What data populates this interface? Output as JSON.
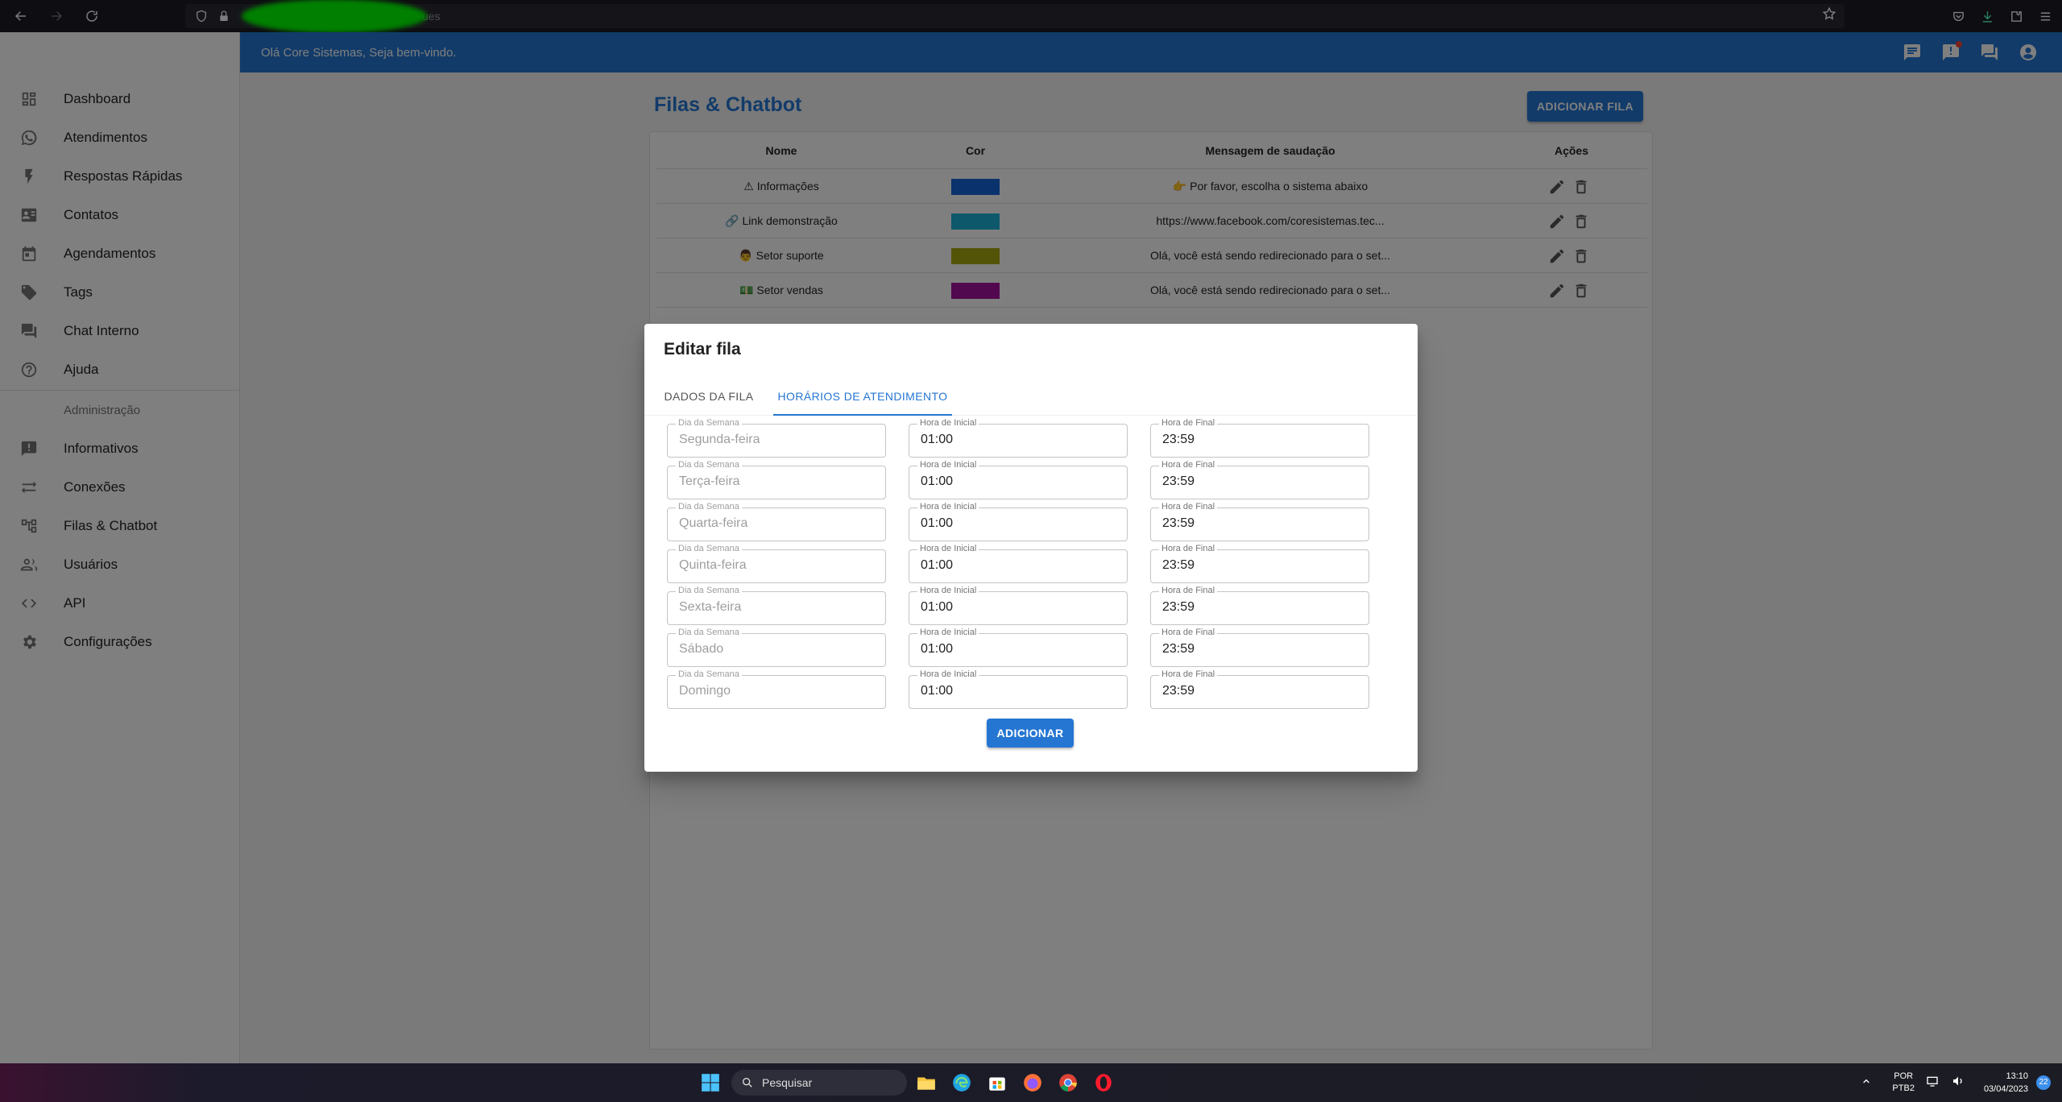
{
  "browser": {
    "url_suffix": "ues",
    "icons": [
      "back-arrow-icon",
      "forward-arrow-icon",
      "reload-icon",
      "shield-icon",
      "lock-icon",
      "star-icon",
      "pocket-icon",
      "download-icon",
      "extensions-icon",
      "menu-icon"
    ]
  },
  "sidebar": {
    "items": [
      {
        "label": "Dashboard",
        "icon": "dashboard-icon"
      },
      {
        "label": "Atendimentos",
        "icon": "whatsapp-icon"
      },
      {
        "label": "Respostas Rápidas",
        "icon": "flash-icon"
      },
      {
        "label": "Contatos",
        "icon": "contacts-icon"
      },
      {
        "label": "Agendamentos",
        "icon": "calendar-icon"
      },
      {
        "label": "Tags",
        "icon": "tag-icon"
      },
      {
        "label": "Chat Interno",
        "icon": "forum-icon"
      },
      {
        "label": "Ajuda",
        "icon": "help-icon"
      }
    ],
    "section_label": "Administração",
    "admin_items": [
      {
        "label": "Informativos",
        "icon": "announcement-icon"
      },
      {
        "label": "Conexões",
        "icon": "sync-alt-icon"
      },
      {
        "label": "Filas & Chatbot",
        "icon": "account-tree-icon"
      },
      {
        "label": "Usuários",
        "icon": "people-icon"
      },
      {
        "label": "API",
        "icon": "code-icon"
      },
      {
        "label": "Configurações",
        "icon": "settings-icon"
      }
    ]
  },
  "topbar": {
    "greeting": "Olá Core Sistemas, Seja bem-vindo.",
    "color": "#2576d2"
  },
  "page": {
    "title": "Filas & Chatbot",
    "add_button": "ADICIONAR FILA",
    "columns": [
      "Nome",
      "Cor",
      "Mensagem de saudação",
      "Ações"
    ],
    "rows": [
      {
        "name": "⚠ Informações",
        "color": "#1565d8",
        "message": "👉 Por favor, escolha o sistema abaixo"
      },
      {
        "name": "🔗 Link demonstração",
        "color": "#1ab3d6",
        "message": "https://www.facebook.com/coresistemas.tec..."
      },
      {
        "name": "👨 Setor suporte",
        "color": "#a8a812",
        "message": "Olá, você está sendo redirecionado para o set..."
      },
      {
        "name": "💵 Setor vendas",
        "color": "#a5119c",
        "message": "Olá, você está sendo redirecionado para o set..."
      }
    ]
  },
  "dialog": {
    "title": "Editar fila",
    "tabs": [
      "DADOS DA FILA",
      "HORÁRIOS DE ATENDIMENTO"
    ],
    "active_tab": 1,
    "labels": {
      "day": "Dia da Semana",
      "start": "Hora de Inicial",
      "end": "Hora de Final"
    },
    "schedule": [
      {
        "day": "Segunda-feira",
        "start": "01:00",
        "end": "23:59"
      },
      {
        "day": "Terça-feira",
        "start": "01:00",
        "end": "23:59"
      },
      {
        "day": "Quarta-feira",
        "start": "01:00",
        "end": "23:59"
      },
      {
        "day": "Quinta-feira",
        "start": "01:00",
        "end": "23:59"
      },
      {
        "day": "Sexta-feira",
        "start": "01:00",
        "end": "23:59"
      },
      {
        "day": "Sábado",
        "start": "01:00",
        "end": "23:59"
      },
      {
        "day": "Domingo",
        "start": "01:00",
        "end": "23:59"
      }
    ],
    "add_button": "ADICIONAR"
  },
  "taskbar": {
    "search_placeholder": "Pesquisar",
    "lang_top": "POR",
    "lang_bottom": "PTB2",
    "time": "13:10",
    "date": "03/04/2023",
    "notification_count": "22"
  }
}
